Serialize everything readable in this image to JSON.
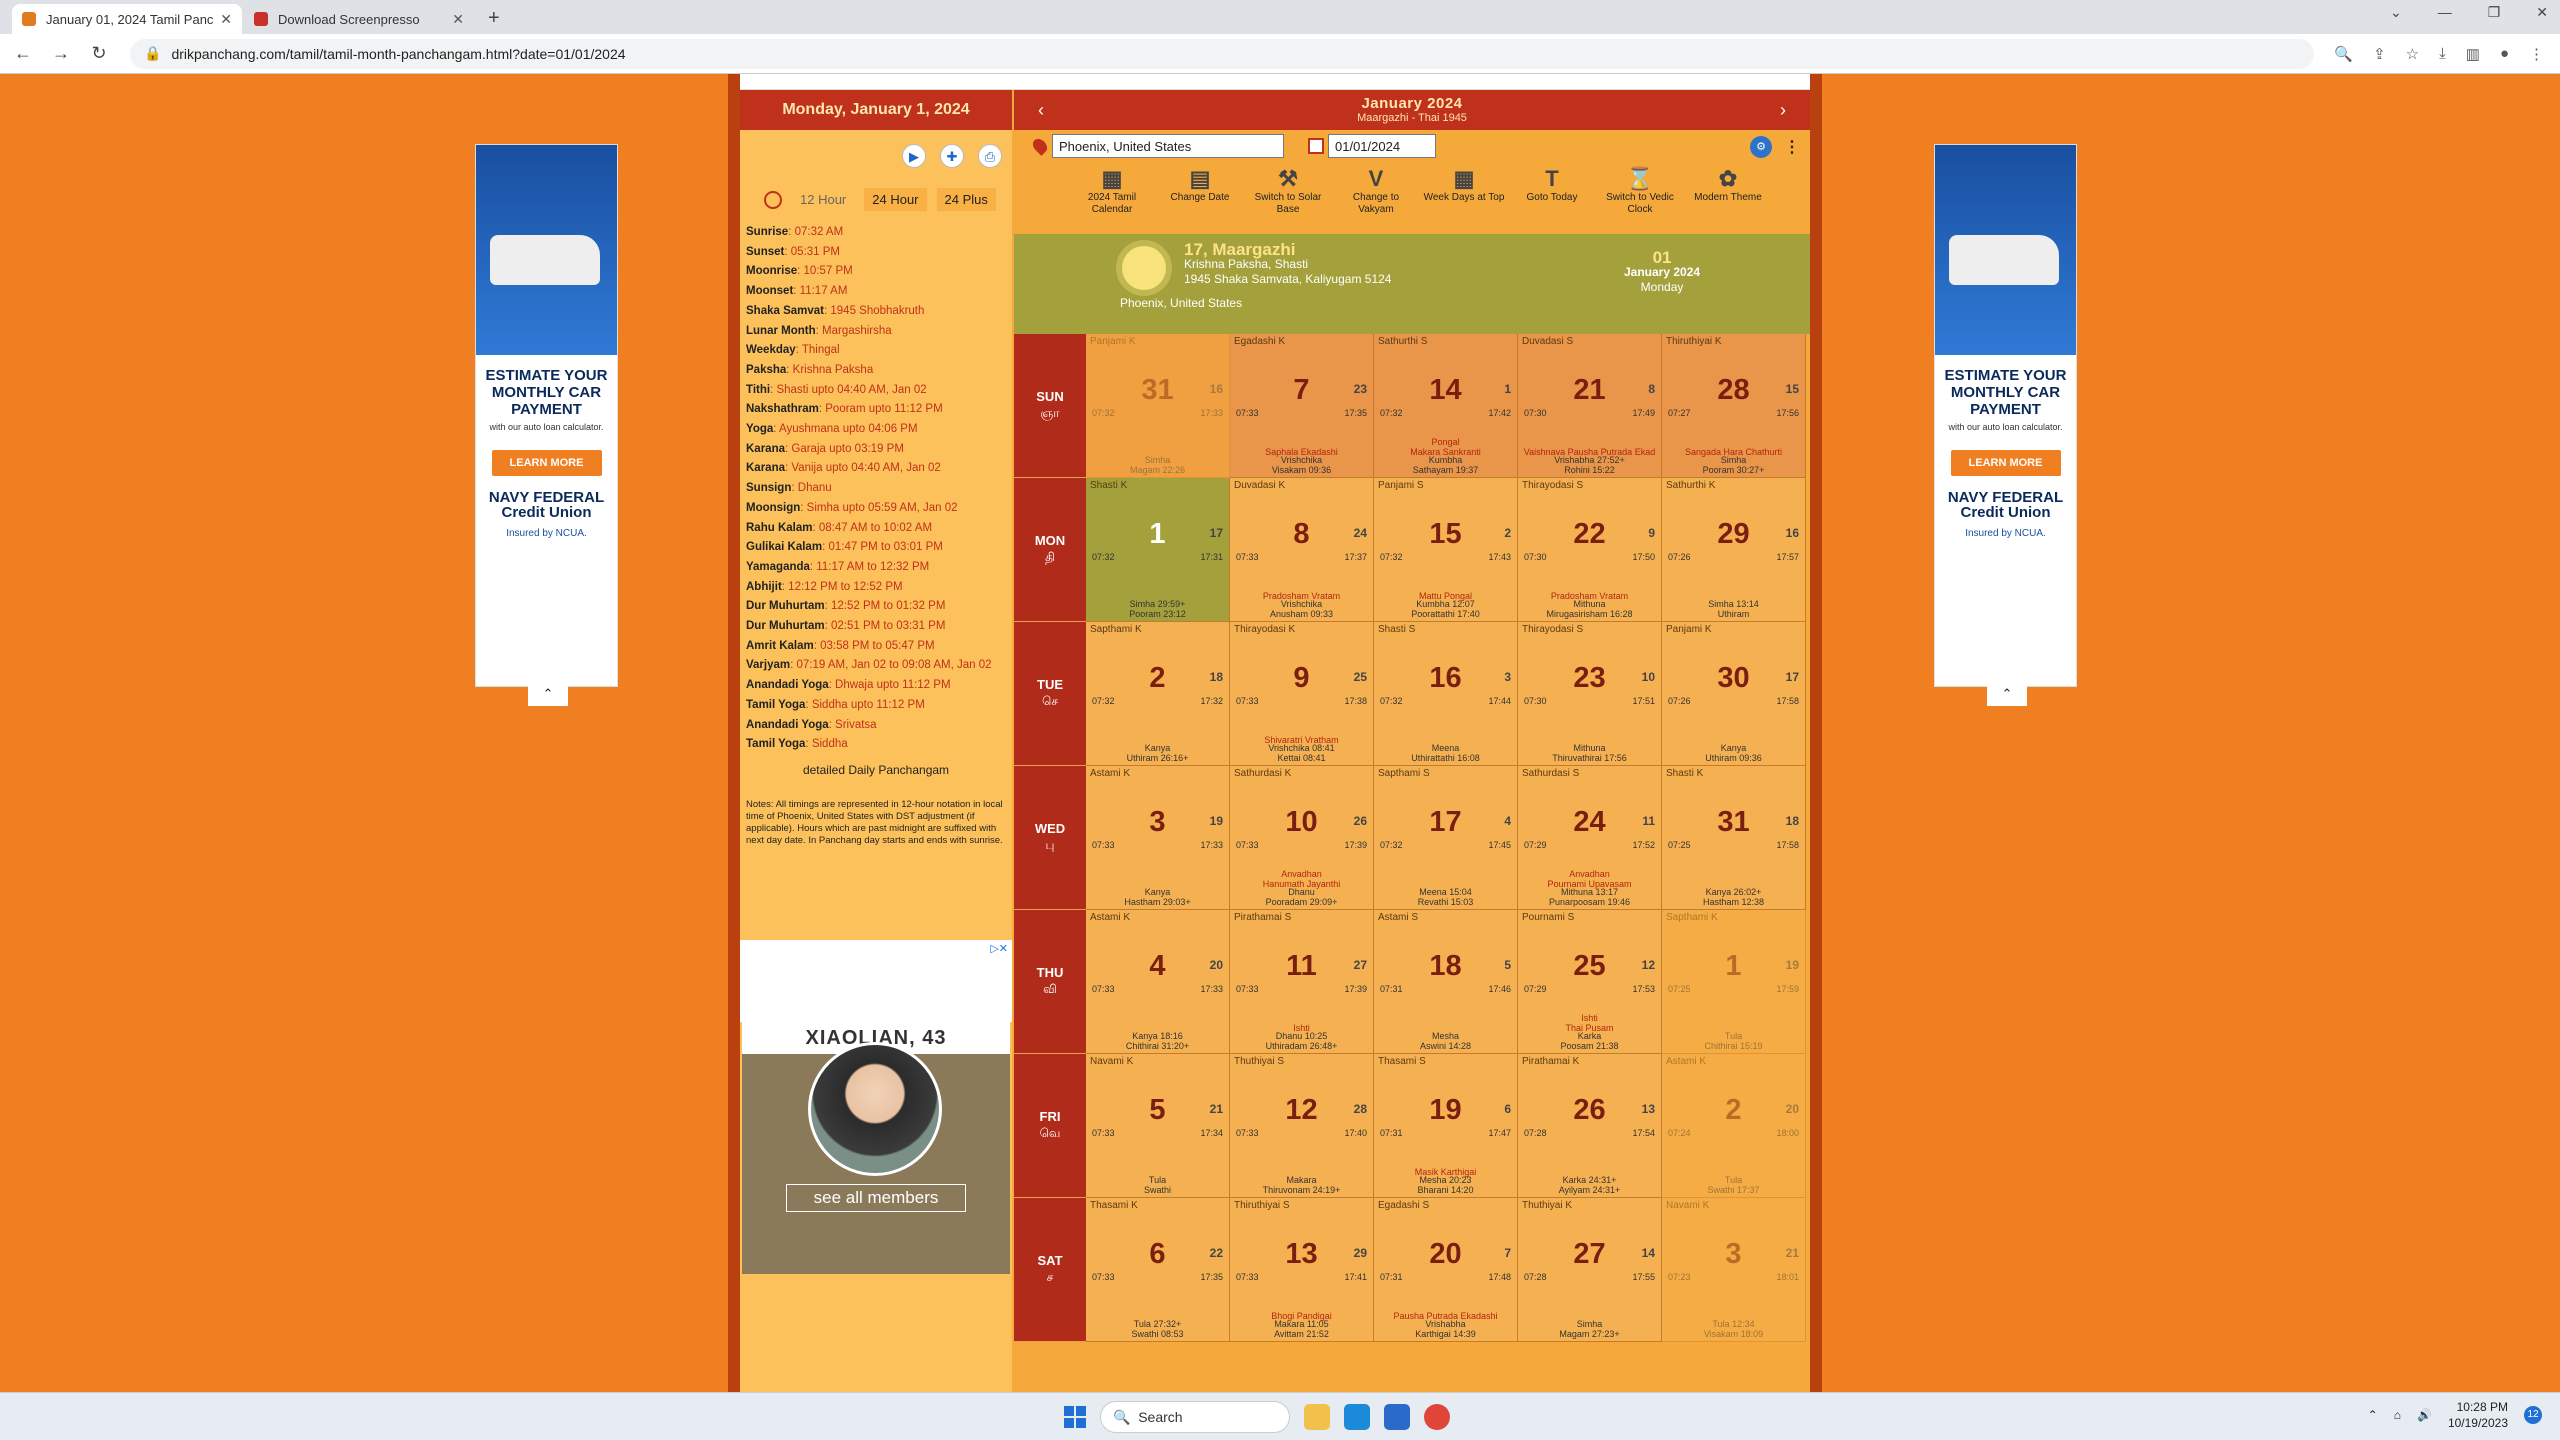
{
  "browser": {
    "tabs": [
      {
        "title": "January 01, 2024 Tamil Panchang",
        "active": true
      },
      {
        "title": "Download Screenpresso",
        "active": false
      }
    ],
    "url": "drikpanchang.com/tamil/tamil-month-panchangam.html?date=01/01/2024"
  },
  "ads": {
    "headline": "ESTIMATE YOUR MONTHLY CAR PAYMENT",
    "sub": "with our auto loan calculator.",
    "cta": "LEARN MORE",
    "brand": "NAVY FEDERAL Credit Union",
    "insured": "Insured by NCUA."
  },
  "left": {
    "header": "Monday, January 1, 2024",
    "tabs": [
      "12 Hour",
      "24 Hour",
      "24 Plus"
    ],
    "details": [
      {
        "k": "Sunrise",
        "v": ": 07:32 AM"
      },
      {
        "k": "Sunset",
        "v": ": 05:31 PM"
      },
      {
        "k": "Moonrise",
        "v": ": 10:57 PM"
      },
      {
        "k": "Moonset",
        "v": ": 11:17 AM"
      },
      {
        "k": "Shaka Samvat",
        "v": ": 1945 Shobhakruth"
      },
      {
        "k": "Lunar Month",
        "v": ": Margashirsha"
      },
      {
        "k": "Weekday",
        "v": ": Thingal"
      },
      {
        "k": "Paksha",
        "v": ": Krishna Paksha"
      },
      {
        "k": "Tithi",
        "v": ": Shasti upto 04:40 AM, Jan 02"
      },
      {
        "k": "Nakshathram",
        "v": ": Pooram upto 11:12 PM"
      },
      {
        "k": "Yoga",
        "v": ": Ayushmana upto 04:06 PM"
      },
      {
        "k": "Karana",
        "v": ": Garaja upto 03:19 PM"
      },
      {
        "k": "Karana",
        "v": ": Vanija upto 04:40 AM, Jan 02"
      },
      {
        "k": "Sunsign",
        "v": ": Dhanu"
      },
      {
        "k": "Moonsign",
        "v": ": Simha upto 05:59 AM, Jan 02"
      },
      {
        "k": "Rahu Kalam",
        "v": ": 08:47 AM to 10:02 AM"
      },
      {
        "k": "Gulikai Kalam",
        "v": ": 01:47 PM to 03:01 PM"
      },
      {
        "k": "Yamaganda",
        "v": ": 11:17 AM to 12:32 PM"
      },
      {
        "k": "Abhijit",
        "v": ": 12:12 PM to 12:52 PM"
      },
      {
        "k": "Dur Muhurtam",
        "v": ": 12:52 PM to 01:32 PM"
      },
      {
        "k": "Dur Muhurtam",
        "v": ": 02:51 PM to 03:31 PM"
      },
      {
        "k": "Amrit Kalam",
        "v": ": 03:58 PM to 05:47 PM"
      },
      {
        "k": "Varjyam",
        "v": ": 07:19 AM, Jan 02 to 09:08 AM, Jan 02"
      },
      {
        "k": "Anandadi Yoga",
        "v": ": Dhwaja upto 11:12 PM"
      },
      {
        "k": "Tamil Yoga",
        "v": ": Siddha upto 11:12 PM"
      },
      {
        "k": "Anandadi Yoga",
        "v": ": Srivatsa"
      },
      {
        "k": "Tamil Yoga",
        "v": ": Siddha"
      }
    ],
    "detailed_link": "detailed Daily Panchangam",
    "notes": "Notes: All timings are represented in 12-hour notation in local time of Phoenix, United States with DST adjustment (if applicable). Hours which are past midnight are suffixed with next day date. In Panchang day starts and ends with sunrise.",
    "promo": {
      "name": "XIAOLIAN, 43",
      "button": "see all members"
    }
  },
  "calendar": {
    "title": "January 2024",
    "subtitle": "Maargazhi - Thai 1945",
    "location": "Phoenix, United States",
    "date": "01/01/2024",
    "tools": [
      {
        "icon": "▦",
        "label": "2024 Tamil Calendar"
      },
      {
        "icon": "▤",
        "label": "Change Date"
      },
      {
        "icon": "⚒",
        "label": "Switch to Solar Base"
      },
      {
        "icon": "V",
        "label": "Change to Vakyam"
      },
      {
        "icon": "▦",
        "label": "Week Days at Top"
      },
      {
        "icon": "T",
        "label": "Goto Today"
      },
      {
        "icon": "⌛",
        "label": "Switch to Vedic Clock"
      },
      {
        "icon": "✿",
        "label": "Modern Theme"
      }
    ],
    "today": {
      "tamil_date": "17, Maargazhi",
      "paksha": "Krishna Paksha, Shasti",
      "samvat": "1945 Shaka Samvata, Kaliyugam 5124",
      "place": "Phoenix, United States",
      "day": "01",
      "month": "January 2024",
      "weekday": "Monday"
    },
    "weekdays": [
      {
        "en": "SUN",
        "ta": "ஞா"
      },
      {
        "en": "MON",
        "ta": "தி"
      },
      {
        "en": "TUE",
        "ta": "செ"
      },
      {
        "en": "WED",
        "ta": "பு"
      },
      {
        "en": "THU",
        "ta": "வி"
      },
      {
        "en": "FRI",
        "ta": "வெ"
      },
      {
        "en": "SAT",
        "ta": "ச"
      }
    ]
  }
}
